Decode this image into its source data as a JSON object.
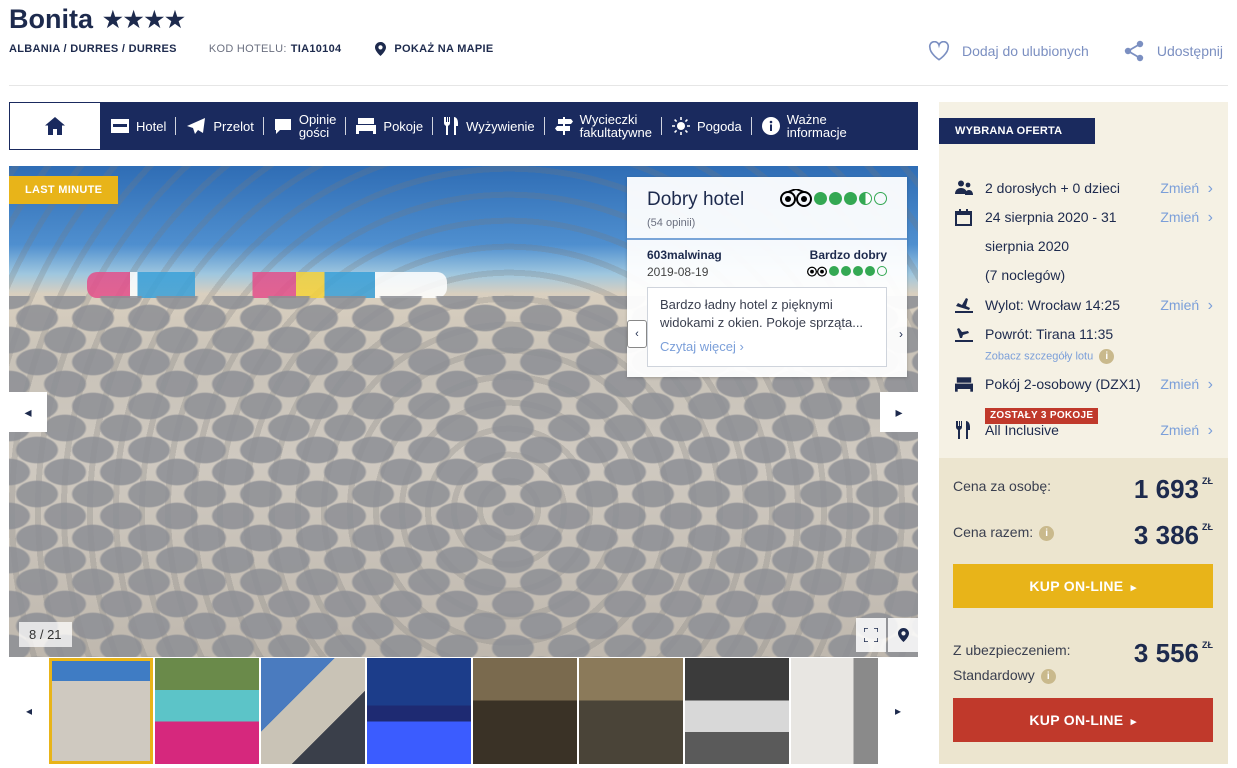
{
  "header": {
    "hotel_name": "Bonita",
    "stars": "★★★★",
    "location": "ALBANIA / DURRES / DURRES",
    "hotel_code_label": "KOD HOTELU:",
    "hotel_code": "TIA10104",
    "map_link": "POKAŻ NA MAPIE",
    "favorite": "Dodaj do ulubionych",
    "share": "Udostępnij"
  },
  "nav": {
    "items": [
      {
        "label": "Hotel"
      },
      {
        "label": "Przelot"
      },
      {
        "label": "Opinie gości",
        "line1": "Opinie",
        "line2": "gości"
      },
      {
        "label": "Pokoje"
      },
      {
        "label": "Wyżywienie"
      },
      {
        "label": "Wycieczki fakultatywne",
        "line1": "Wycieczki",
        "line2": "fakultatywne"
      },
      {
        "label": "Pogoda"
      },
      {
        "label": "Ważne informacje",
        "line1": "Ważne",
        "line2": "informacje"
      }
    ]
  },
  "gallery": {
    "badge": "LAST MINUTE",
    "counter": "8 / 21",
    "review": {
      "summary": "Dobry hotel",
      "count": "(54 opinii)",
      "score": 3.5,
      "author": "603malwinag",
      "date": "2019-08-19",
      "rating_text": "Bardzo dobry",
      "author_score": 4,
      "text": "Bardzo ładny hotel z pięknymi widokami z okien. Pokoje sprząta...",
      "more": "Czytaj więcej"
    }
  },
  "offer": {
    "tag": "WYBRANA OFERTA",
    "change_label": "Zmień",
    "travellers": "2 dorosłych + 0 dzieci",
    "dates": "24 sierpnia 2020 - 31 sierpnia 2020",
    "nights": "(7 noclegów)",
    "departure": "Wylot: Wrocław 14:25",
    "return": "Powrót: Tirana 11:35",
    "flight_details": "Zobacz szczegóły lotu",
    "room": "Pokój 2-osobowy (DZX1)",
    "rooms_left": "ZOSTAŁY 3 POKOJE",
    "board": "All Inclusive",
    "price_person_label": "Cena za osobę:",
    "price_person": "1 693",
    "price_total_label": "Cena razem:",
    "price_total": "3 386",
    "currency": "ZŁ",
    "buy_label": "KUP ON-LINE",
    "insurance_label_1": "Z ubezpieczeniem:",
    "insurance_label_2": "Standardowy",
    "price_insured": "3 556",
    "info_icon": "i"
  },
  "colors": {
    "navy": "#1a2a5e",
    "accent_yellow": "#e8b419",
    "accent_red": "#c0392b",
    "link_blue": "#7b9fd9",
    "tripadvisor_green": "#34a853"
  }
}
